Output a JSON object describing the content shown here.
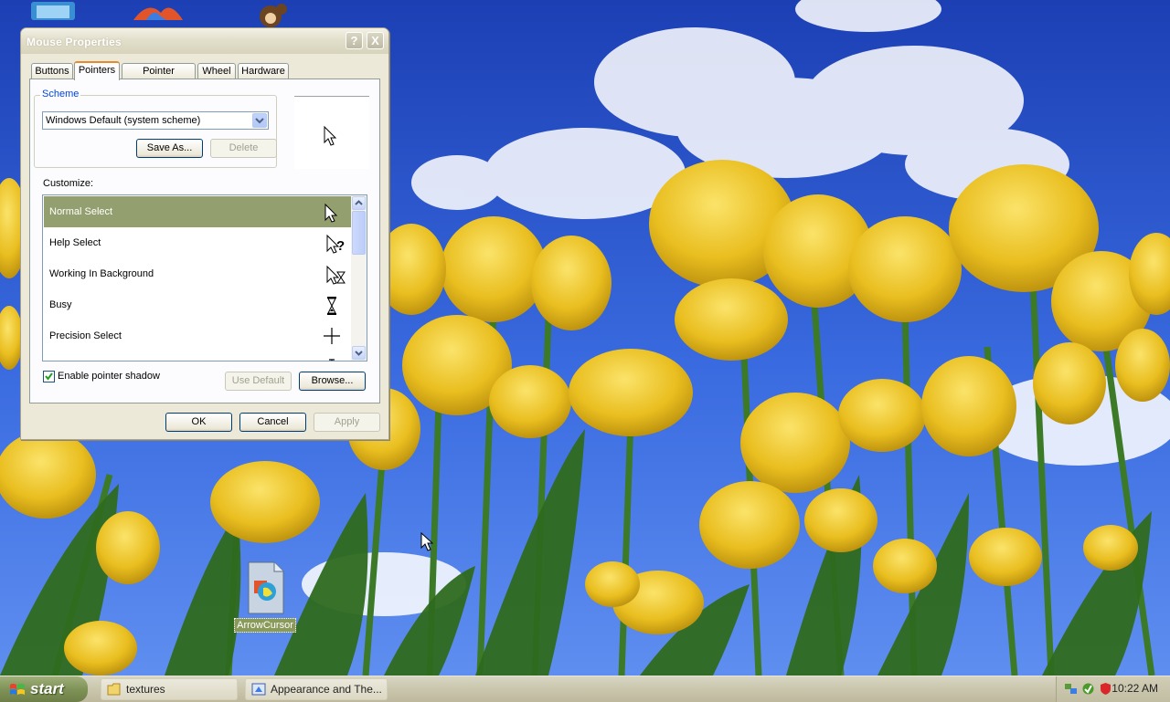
{
  "window": {
    "title": "Mouse Properties",
    "help_label": "?",
    "close_label": "X"
  },
  "tabs": [
    "Buttons",
    "Pointers",
    "Pointer Options",
    "Wheel",
    "Hardware"
  ],
  "active_tab": "Pointers",
  "scheme": {
    "legend": "Scheme",
    "selected": "Windows Default (system scheme)",
    "save_as_label": "Save As...",
    "delete_label": "Delete"
  },
  "customize": {
    "label": "Customize:",
    "items": [
      {
        "name": "Normal Select",
        "icon": "arrow-cursor-icon",
        "selected": true
      },
      {
        "name": "Help Select",
        "icon": "help-cursor-icon",
        "selected": false
      },
      {
        "name": "Working In Background",
        "icon": "working-cursor-icon",
        "selected": false
      },
      {
        "name": "Busy",
        "icon": "hourglass-icon",
        "selected": false
      },
      {
        "name": "Precision Select",
        "icon": "crosshair-icon",
        "selected": false
      }
    ]
  },
  "shadow": {
    "label": "Enable pointer shadow",
    "checked": true
  },
  "buttons": {
    "use_default": "Use Default",
    "browse": "Browse...",
    "ok": "OK",
    "cancel": "Cancel",
    "apply": "Apply"
  },
  "desktop_icon": {
    "label": "ArrowCursor"
  },
  "taskbar": {
    "start_label": "start",
    "tasks": [
      {
        "label": "textures",
        "icon": "folder-icon"
      },
      {
        "label": "Appearance and The...",
        "icon": "control-panel-icon"
      }
    ],
    "clock": "10:22 AM"
  },
  "colors": {
    "selection": "#949f6f",
    "tab_highlight": "#e68b2c",
    "group_legend": "#0046d5",
    "start_button": "#7f9257"
  }
}
